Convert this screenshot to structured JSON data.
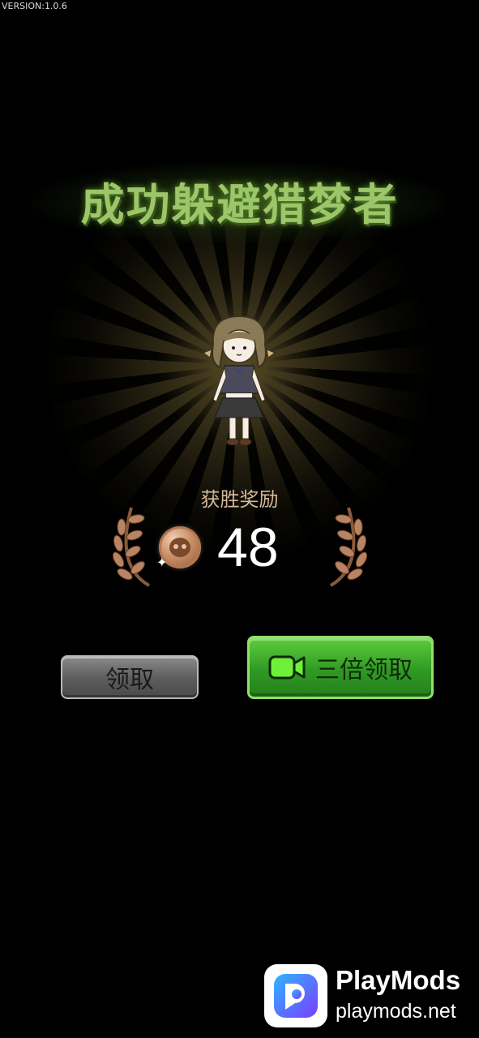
{
  "version": "VERSION:1.0.6",
  "title": "成功躲避猎梦者",
  "reward": {
    "label": "获胜奖励",
    "amount": "48",
    "currency_icon": "bronze-coin-icon"
  },
  "buttons": {
    "claim": "领取",
    "triple_claim": "三倍领取",
    "triple_icon": "video-icon"
  },
  "watermark": {
    "name": "PlayMods",
    "url": "playmods.net"
  },
  "colors": {
    "title": "#9dc66a",
    "reward_label": "#d4b99a",
    "green_button": "#2f9a24",
    "gray_button": "#5c5c5c",
    "coin": "#c88d66"
  }
}
